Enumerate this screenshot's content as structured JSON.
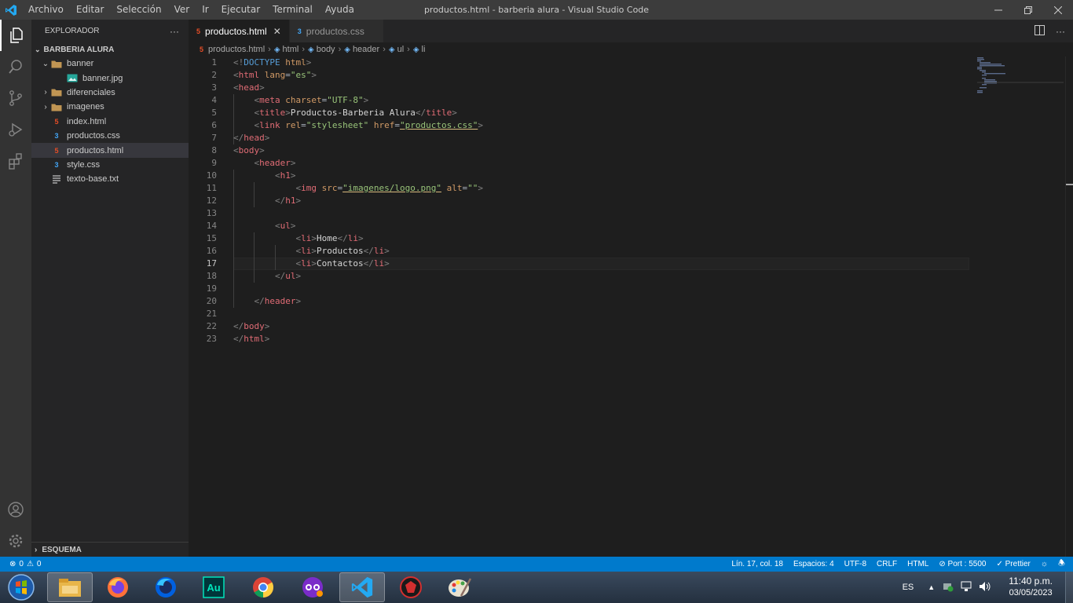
{
  "window": {
    "title": "productos.html - barberia alura - Visual Studio Code",
    "menu": [
      "Archivo",
      "Editar",
      "Selección",
      "Ver",
      "Ir",
      "Ejecutar",
      "Terminal",
      "Ayuda"
    ]
  },
  "sidebar": {
    "header": "EXPLORADOR",
    "more": "···",
    "folder": "BARBERIA ALURA",
    "items": [
      {
        "label": "banner",
        "type": "folder",
        "open": true,
        "depth": 0
      },
      {
        "label": "banner.jpg",
        "type": "image",
        "depth": 1
      },
      {
        "label": "diferenciales",
        "type": "folder",
        "open": false,
        "depth": 0
      },
      {
        "label": "imagenes",
        "type": "folder",
        "open": false,
        "depth": 0
      },
      {
        "label": "index.html",
        "type": "html",
        "depth": 0
      },
      {
        "label": "productos.css",
        "type": "css",
        "depth": 0
      },
      {
        "label": "productos.html",
        "type": "html",
        "depth": 0,
        "selected": true
      },
      {
        "label": "style.css",
        "type": "css",
        "depth": 0
      },
      {
        "label": "texto-base.txt",
        "type": "txt",
        "depth": 0
      }
    ],
    "outline": "ESQUEMA"
  },
  "tabs": [
    {
      "label": "productos.html",
      "type": "html",
      "active": true
    },
    {
      "label": "productos.css",
      "type": "css",
      "active": false
    }
  ],
  "breadcrumb": [
    "productos.html",
    "html",
    "body",
    "header",
    "ul",
    "li"
  ],
  "editor": {
    "current_line": 17,
    "lines": [
      [
        [
          "tp",
          "<!"
        ],
        [
          "dt",
          "DOCTYPE"
        ],
        [
          "tx",
          " "
        ],
        [
          "an",
          "html"
        ],
        [
          "tp",
          ">"
        ]
      ],
      [
        [
          "tp",
          "<"
        ],
        [
          "tn",
          "html"
        ],
        [
          "tx",
          " "
        ],
        [
          "an",
          "lang"
        ],
        [
          "pt",
          "="
        ],
        [
          "sv",
          "\"es\""
        ],
        [
          "tp",
          ">"
        ]
      ],
      [
        [
          "tp",
          "<"
        ],
        [
          "tn",
          "head"
        ],
        [
          "tp",
          ">"
        ]
      ],
      [
        [
          "tx",
          "    "
        ],
        [
          "tp",
          "<"
        ],
        [
          "tn",
          "meta"
        ],
        [
          "tx",
          " "
        ],
        [
          "an",
          "charset"
        ],
        [
          "pt",
          "="
        ],
        [
          "sv",
          "\"UTF-8\""
        ],
        [
          "tp",
          ">"
        ]
      ],
      [
        [
          "tx",
          "    "
        ],
        [
          "tp",
          "<"
        ],
        [
          "tn",
          "title"
        ],
        [
          "tp",
          ">"
        ],
        [
          "tx",
          "Productos-Barberia Alura"
        ],
        [
          "tp",
          "</"
        ],
        [
          "tn",
          "title"
        ],
        [
          "tp",
          ">"
        ]
      ],
      [
        [
          "tx",
          "    "
        ],
        [
          "tp",
          "<"
        ],
        [
          "tn",
          "link"
        ],
        [
          "tx",
          " "
        ],
        [
          "an",
          "rel"
        ],
        [
          "pt",
          "="
        ],
        [
          "sv",
          "\"stylesheet\""
        ],
        [
          "tx",
          " "
        ],
        [
          "an",
          "href"
        ],
        [
          "pt",
          "="
        ],
        [
          "svu",
          "\"productos.css\""
        ],
        [
          "tp",
          ">"
        ]
      ],
      [
        [
          "tp",
          "</"
        ],
        [
          "tn",
          "head"
        ],
        [
          "tp",
          ">"
        ]
      ],
      [
        [
          "tp",
          "<"
        ],
        [
          "tn",
          "body"
        ],
        [
          "tp",
          ">"
        ]
      ],
      [
        [
          "tx",
          "    "
        ],
        [
          "tp",
          "<"
        ],
        [
          "tn",
          "header"
        ],
        [
          "tp",
          ">"
        ]
      ],
      [
        [
          "tx",
          "        "
        ],
        [
          "tp",
          "<"
        ],
        [
          "tn",
          "h1"
        ],
        [
          "tp",
          ">"
        ]
      ],
      [
        [
          "tx",
          "            "
        ],
        [
          "tp",
          "<"
        ],
        [
          "tn",
          "img"
        ],
        [
          "tx",
          " "
        ],
        [
          "an",
          "src"
        ],
        [
          "pt",
          "="
        ],
        [
          "svu",
          "\"imagenes/logo.png\""
        ],
        [
          "tx",
          " "
        ],
        [
          "an",
          "alt"
        ],
        [
          "pt",
          "="
        ],
        [
          "sv",
          "\"\""
        ],
        [
          "tp",
          ">"
        ]
      ],
      [
        [
          "tx",
          "        "
        ],
        [
          "tp",
          "</"
        ],
        [
          "tn",
          "h1"
        ],
        [
          "tp",
          ">"
        ]
      ],
      [],
      [
        [
          "tx",
          "        "
        ],
        [
          "tp",
          "<"
        ],
        [
          "tn",
          "ul"
        ],
        [
          "tp",
          ">"
        ]
      ],
      [
        [
          "tx",
          "            "
        ],
        [
          "tp",
          "<"
        ],
        [
          "tn",
          "li"
        ],
        [
          "tp",
          ">"
        ],
        [
          "tx",
          "Home"
        ],
        [
          "tp",
          "</"
        ],
        [
          "tn",
          "li"
        ],
        [
          "tp",
          ">"
        ]
      ],
      [
        [
          "tx",
          "            "
        ],
        [
          "tp",
          "<"
        ],
        [
          "tn",
          "li"
        ],
        [
          "tp",
          ">"
        ],
        [
          "tx",
          "Productos"
        ],
        [
          "tp",
          "</"
        ],
        [
          "tn",
          "li"
        ],
        [
          "tp",
          ">"
        ]
      ],
      [
        [
          "tx",
          "            "
        ],
        [
          "tp",
          "<"
        ],
        [
          "tn",
          "li"
        ],
        [
          "tp",
          ">"
        ],
        [
          "tx",
          "Contactos"
        ],
        [
          "tp",
          "</"
        ],
        [
          "tn",
          "li"
        ],
        [
          "tp",
          ">"
        ]
      ],
      [
        [
          "tx",
          "        "
        ],
        [
          "tp",
          "</"
        ],
        [
          "tn",
          "ul"
        ],
        [
          "tp",
          ">"
        ]
      ],
      [],
      [
        [
          "tx",
          "    "
        ],
        [
          "tp",
          "</"
        ],
        [
          "tn",
          "header"
        ],
        [
          "tp",
          ">"
        ]
      ],
      [],
      [
        [
          "tp",
          "</"
        ],
        [
          "tn",
          "body"
        ],
        [
          "tp",
          ">"
        ]
      ],
      [
        [
          "tp",
          "</"
        ],
        [
          "tn",
          "html"
        ],
        [
          "tp",
          ">"
        ]
      ]
    ]
  },
  "statusbar": {
    "errors": "0",
    "warnings": "0",
    "position": "Lín. 17, col. 18",
    "spaces": "Espacios: 4",
    "encoding": "UTF-8",
    "eol": "CRLF",
    "language": "HTML",
    "port": "Port : 5500",
    "prettier": "Prettier"
  },
  "taskbar": {
    "apps": [
      "start",
      "file-explorer",
      "firefox",
      "firefox-developer",
      "audition",
      "chrome",
      "incognito-browser",
      "vscode",
      "security-app",
      "paint"
    ],
    "language": "ES",
    "time": "11:40 p.m.",
    "date": "03/05/2023"
  },
  "colors": {
    "statusbar": "#007acc",
    "html_icon": "#e44d26",
    "css_icon": "#42a5f5"
  }
}
